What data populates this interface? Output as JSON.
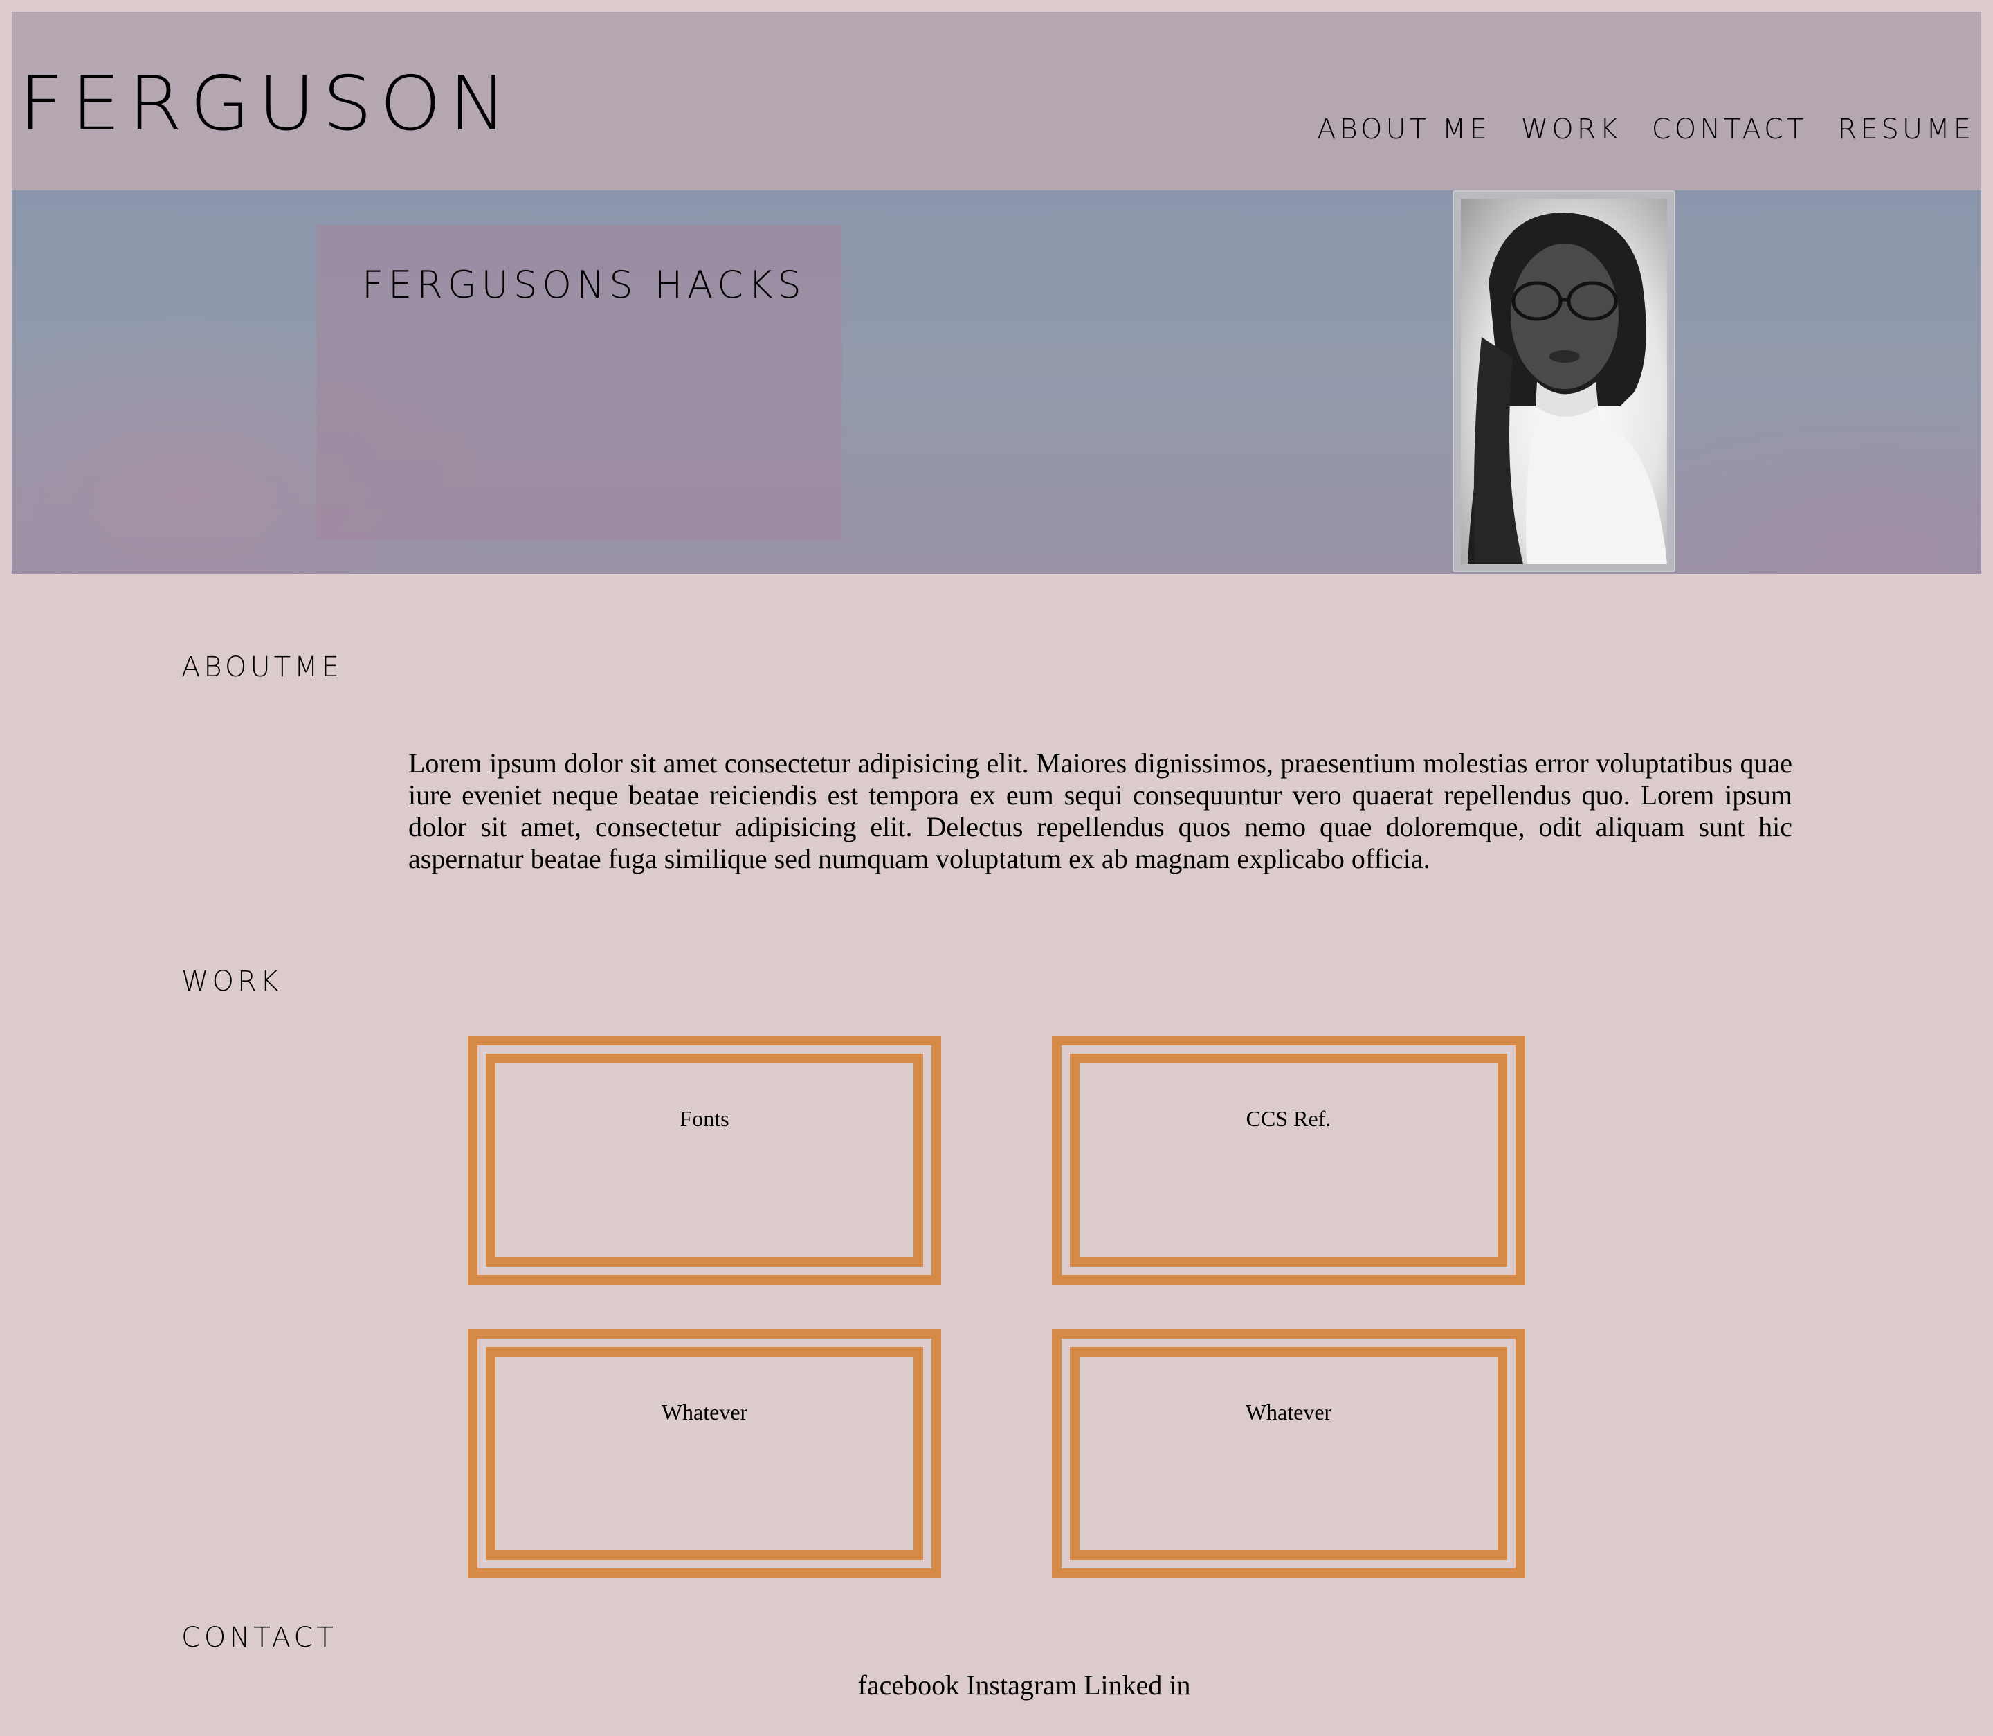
{
  "header": {
    "brand": "FERGUSON",
    "nav": [
      {
        "label": "ABOUT ME"
      },
      {
        "label": "WORK"
      },
      {
        "label": "CONTACT"
      },
      {
        "label": "RESUME"
      }
    ]
  },
  "hero": {
    "title": "FERGUSONS HACKS",
    "portrait_alt": "profile-photo"
  },
  "about": {
    "heading": "ABOUTME",
    "text": "Lorem ipsum dolor sit amet consectetur adipisicing elit. Maiores dignissimos, praesentium molestias error voluptatibus quae iure eveniet neque beatae reiciendis est tempora ex eum sequi consequuntur vero quaerat repellendus quo. Lorem ipsum dolor sit amet, consectetur adipisicing elit. Delectus repellendus quos nemo quae doloremque, odit aliquam sunt hic aspernatur beatae fuga similique sed numquam voluptatum ex ab magnam explicabo officia."
  },
  "work": {
    "heading": "WORK",
    "cards": [
      {
        "label": "Fonts"
      },
      {
        "label": "CCS Ref."
      },
      {
        "label": "Whatever"
      },
      {
        "label": "Whatever"
      }
    ]
  },
  "contact": {
    "heading": "CONTACT",
    "links": [
      {
        "label": "facebook"
      },
      {
        "label": "Instagram"
      },
      {
        "label": "Linked in"
      }
    ]
  },
  "colors": {
    "page_background": "#dccbcc",
    "header_background": "#b5a7b2",
    "card_border": "#d58a48"
  }
}
